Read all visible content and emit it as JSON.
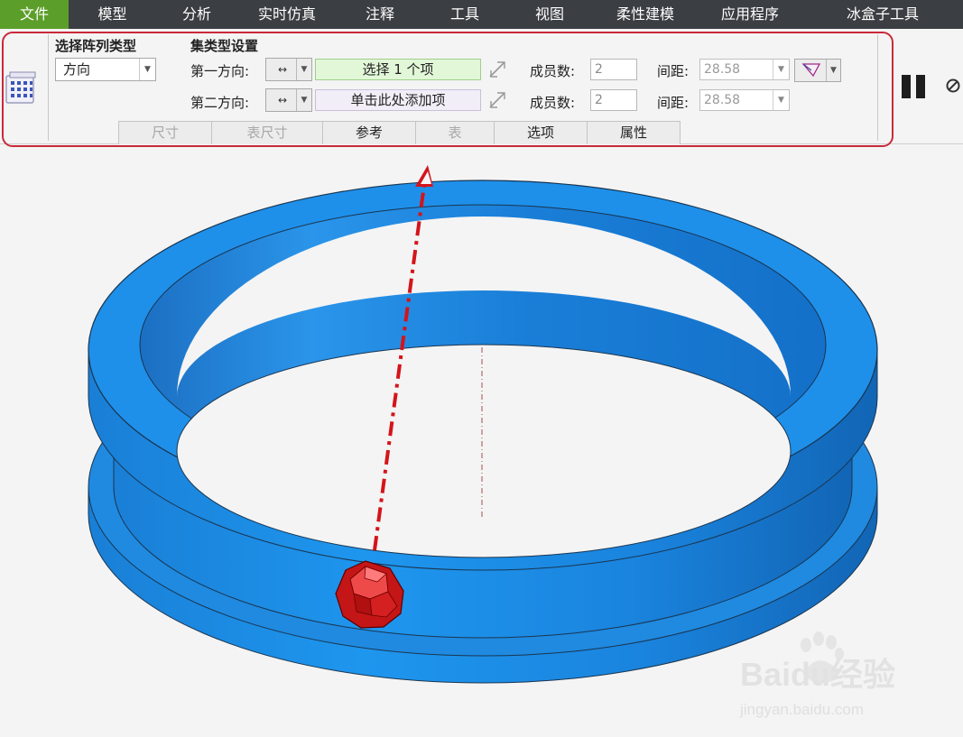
{
  "menu": [
    {
      "label": "文件",
      "active": true
    },
    {
      "label": "模型"
    },
    {
      "label": "分析"
    },
    {
      "label": "实时仿真"
    },
    {
      "label": "注释"
    },
    {
      "label": "工具"
    },
    {
      "label": "视图"
    },
    {
      "label": "柔性建模"
    },
    {
      "label": "应用程序"
    },
    {
      "label": "冰盒子工具"
    }
  ],
  "pattern_type": {
    "title": "选择阵列类型",
    "value": "方向"
  },
  "set_settings": {
    "title": "集类型设置",
    "first": {
      "label": "第一方向:",
      "direction_symbol": "↔",
      "collector": "选择 1 个项",
      "members_label": "成员数:",
      "members": "2",
      "spacing_label": "间距:",
      "spacing": "28.58"
    },
    "second": {
      "label": "第二方向:",
      "direction_symbol": "↔",
      "collector": "单击此处添加项",
      "members_label": "成员数:",
      "members": "2",
      "spacing_label": "间距:",
      "spacing": "28.58"
    }
  },
  "tabs": [
    {
      "label": "尺寸",
      "enabled": false
    },
    {
      "label": "表尺寸",
      "enabled": false
    },
    {
      "label": "参考",
      "enabled": true
    },
    {
      "label": "表",
      "enabled": false
    },
    {
      "label": "选项",
      "enabled": true
    },
    {
      "label": "属性",
      "enabled": true
    }
  ],
  "icons": {
    "pattern": "pattern-grid-icon",
    "flip": "flip-direction-icon",
    "pick": "pick-direction-icon",
    "pause": "pause-icon",
    "cancel": "cancel-icon"
  },
  "colors": {
    "menu_bg": "#3b3e42",
    "menu_active": "#5c9e2a",
    "ring_blue": "#1f8fe6",
    "gem_red": "#d92020",
    "highlight_red": "#c92a3a"
  },
  "watermark": {
    "brand": "Baidu经验",
    "url": "jingyan.baidu.com"
  }
}
